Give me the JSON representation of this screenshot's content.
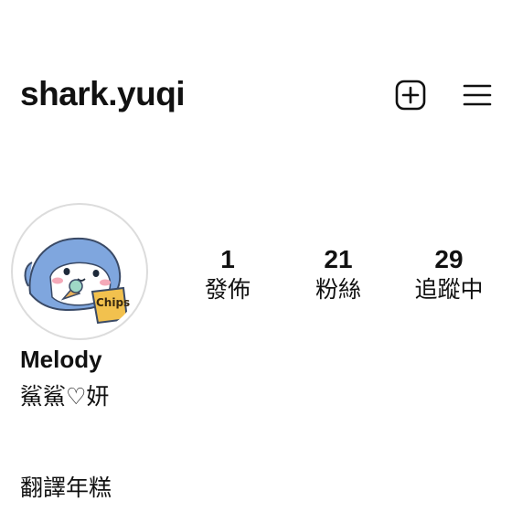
{
  "profile": {
    "username": "shark.yuqi",
    "display_name": "Melody",
    "bio_line1": "鯊鯊♡妍",
    "bio_line2": "翻譯年糕"
  },
  "header": {
    "add_icon": "plus-square-icon",
    "menu_icon": "hamburger-menu-icon"
  },
  "avatar": {
    "sticker_text": "Chips"
  },
  "stats": {
    "posts": {
      "value": "1",
      "label": "發佈"
    },
    "followers": {
      "value": "21",
      "label": "粉絲"
    },
    "following": {
      "value": "29",
      "label": "追蹤中"
    }
  }
}
